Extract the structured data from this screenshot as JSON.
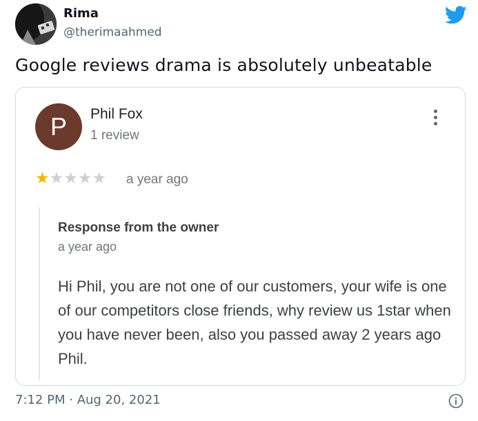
{
  "tweet": {
    "display_name": "Rima",
    "handle": "@therimaahmed",
    "text": "Google reviews drama is absolutely unbeatable",
    "timestamp": "7:12 PM · Aug 20, 2021"
  },
  "review": {
    "avatar_letter": "P",
    "reviewer_name": "Phil Fox",
    "review_count": "1 review",
    "rating": 1,
    "rating_max": 5,
    "time": "a year ago",
    "response": {
      "title": "Response from the owner",
      "time": "a year ago",
      "body": "Hi Phil, you are not one of our customers, your wife is one of our competitors close friends, why review us 1star when you have never been, also you passed away 2 years ago Phil."
    }
  },
  "colors": {
    "twitter_blue": "#1d9bf0",
    "star_gold": "#f5b400",
    "avatar_brown": "#6b3a2c"
  },
  "icons": [
    "twitter-bird-icon",
    "more-vert-icon",
    "star-icon",
    "info-icon"
  ]
}
